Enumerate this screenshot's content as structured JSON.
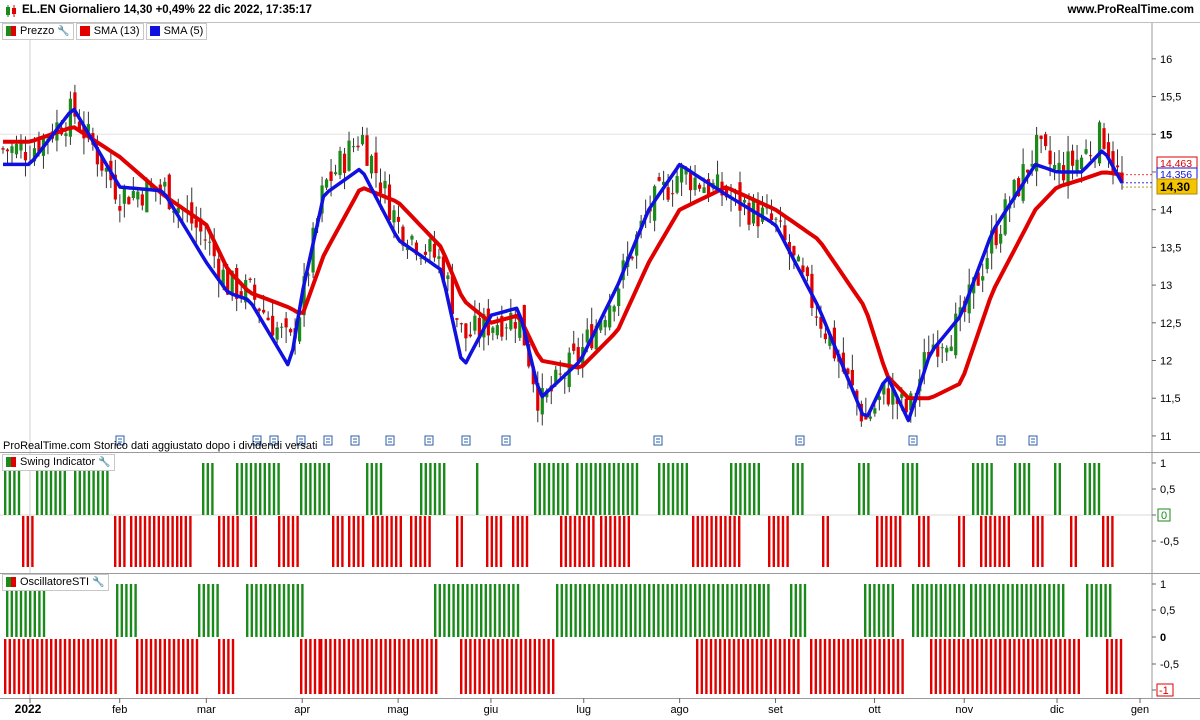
{
  "header": {
    "title": "EL.EN Giornaliero 14,30 +0,49% 22 dic 2022, 17:35:17",
    "site": "www.ProRealTime.com"
  },
  "panel_main": {
    "legend": [
      {
        "label": "Prezzo",
        "color": "#1a8a1a"
      },
      {
        "label": "SMA (13)",
        "color": "#e00000"
      },
      {
        "label": "SMA (5)",
        "color": "#1010e0"
      }
    ],
    "footnote": "ProRealTime.com  Storico dati aggiustato dopo i dividendi versati",
    "y_ticks": [
      "16",
      "15,5",
      "15",
      "14,5",
      "14",
      "13,5",
      "13",
      "12,5",
      "12",
      "11,5",
      "11"
    ],
    "price_tags": [
      "14,463",
      "14,356",
      "14,30"
    ]
  },
  "panel_swing": {
    "label": "Swing Indicator",
    "y_ticks": [
      "1",
      "0,5",
      "0",
      "-0,5"
    ]
  },
  "panel_sti": {
    "label": "OscillatoreSTI",
    "y_ticks": [
      "1",
      "0,5",
      "0",
      "-0,5",
      "-1"
    ]
  },
  "x_axis": {
    "labels": [
      "2022",
      "feb",
      "mar",
      "apr",
      "mag",
      "giu",
      "lug",
      "ago",
      "set",
      "ott",
      "nov",
      "dic",
      "gen"
    ]
  },
  "colors": {
    "up": "#1a8a1a",
    "down": "#e00000",
    "sma13": "#e00000",
    "sma5": "#1010e0",
    "last_price_tag": "#f5c400"
  },
  "chart_data": [
    {
      "type": "candlestick",
      "title": "EL.EN Giornaliero",
      "ylim": [
        10.8,
        16.25
      ],
      "x": [
        "2022-01-03",
        "2022-01-17",
        "2022-02-01",
        "2022-02-15",
        "2022-03-01",
        "2022-03-08",
        "2022-03-15",
        "2022-03-28",
        "2022-04-01",
        "2022-04-08",
        "2022-04-20",
        "2022-05-02",
        "2022-05-16",
        "2022-05-23",
        "2022-06-01",
        "2022-06-10",
        "2022-06-17",
        "2022-06-30",
        "2022-07-12",
        "2022-07-22",
        "2022-08-01",
        "2022-08-16",
        "2022-09-01",
        "2022-09-15",
        "2022-09-30",
        "2022-10-07",
        "2022-10-14",
        "2022-10-21",
        "2022-10-31",
        "2022-11-10",
        "2022-11-24",
        "2022-12-01",
        "2022-12-09",
        "2022-12-16",
        "2022-12-22"
      ],
      "series": [
        {
          "name": "Prezzo",
          "values": [
            14.8,
            15.3,
            14.2,
            14.3,
            13.6,
            13.0,
            12.9,
            12.2,
            12.8,
            14.3,
            15.0,
            13.8,
            13.3,
            12.3,
            12.5,
            12.6,
            11.4,
            12.1,
            13.0,
            14.0,
            14.5,
            14.2,
            13.8,
            12.6,
            11.2,
            11.6,
            11.3,
            12.2,
            12.5,
            13.6,
            14.8,
            14.5,
            14.7,
            15.0,
            14.3
          ]
        },
        {
          "name": "SMA (13)",
          "values": [
            14.9,
            15.1,
            14.7,
            14.2,
            13.8,
            13.2,
            12.9,
            12.7,
            12.6,
            13.4,
            14.3,
            14.1,
            13.5,
            12.8,
            12.5,
            12.6,
            12.0,
            11.9,
            12.4,
            13.3,
            14.0,
            14.3,
            14.0,
            13.6,
            12.7,
            11.8,
            11.5,
            11.5,
            11.7,
            12.9,
            14.0,
            14.3,
            14.4,
            14.5,
            14.463
          ]
        },
        {
          "name": "SMA (5)",
          "values": [
            14.6,
            15.35,
            14.3,
            14.25,
            13.3,
            12.9,
            12.8,
            11.9,
            12.9,
            14.2,
            14.55,
            13.6,
            13.2,
            11.9,
            12.6,
            12.7,
            11.5,
            12.0,
            13.0,
            14.0,
            14.6,
            14.2,
            13.8,
            12.7,
            11.2,
            11.8,
            11.2,
            12.1,
            12.6,
            13.7,
            14.6,
            14.5,
            14.5,
            14.8,
            14.356
          ]
        }
      ],
      "last_close": 14.3,
      "xlabel": "",
      "ylabel": ""
    },
    {
      "type": "bar",
      "title": "Swing Indicator",
      "ylim": [
        -1,
        1
      ],
      "values_note": "bars alternate between +1 (green) and -1 (red)",
      "series": [
        {
          "name": "Swing Indicator",
          "values": [
            1,
            -1,
            1,
            -1,
            1,
            -1,
            1,
            -1,
            1,
            -1,
            1,
            -1,
            1,
            -1,
            1,
            -1,
            1,
            -1,
            1,
            -1,
            1,
            -1,
            1,
            -1,
            1,
            -1,
            1,
            -1,
            1,
            -1,
            1,
            -1,
            1,
            -1
          ]
        }
      ],
      "last_value": 0
    },
    {
      "type": "bar",
      "title": "OscillatoreSTI",
      "ylim": [
        -1,
        1
      ],
      "series": [
        {
          "name": "OscillatoreSTI",
          "values": [
            1,
            -1,
            1,
            -1,
            1,
            -1,
            1,
            -1,
            1,
            -1,
            1,
            -1,
            1,
            -1,
            1,
            -1,
            1,
            -1,
            1,
            -1
          ]
        }
      ],
      "last_value": -1
    }
  ]
}
